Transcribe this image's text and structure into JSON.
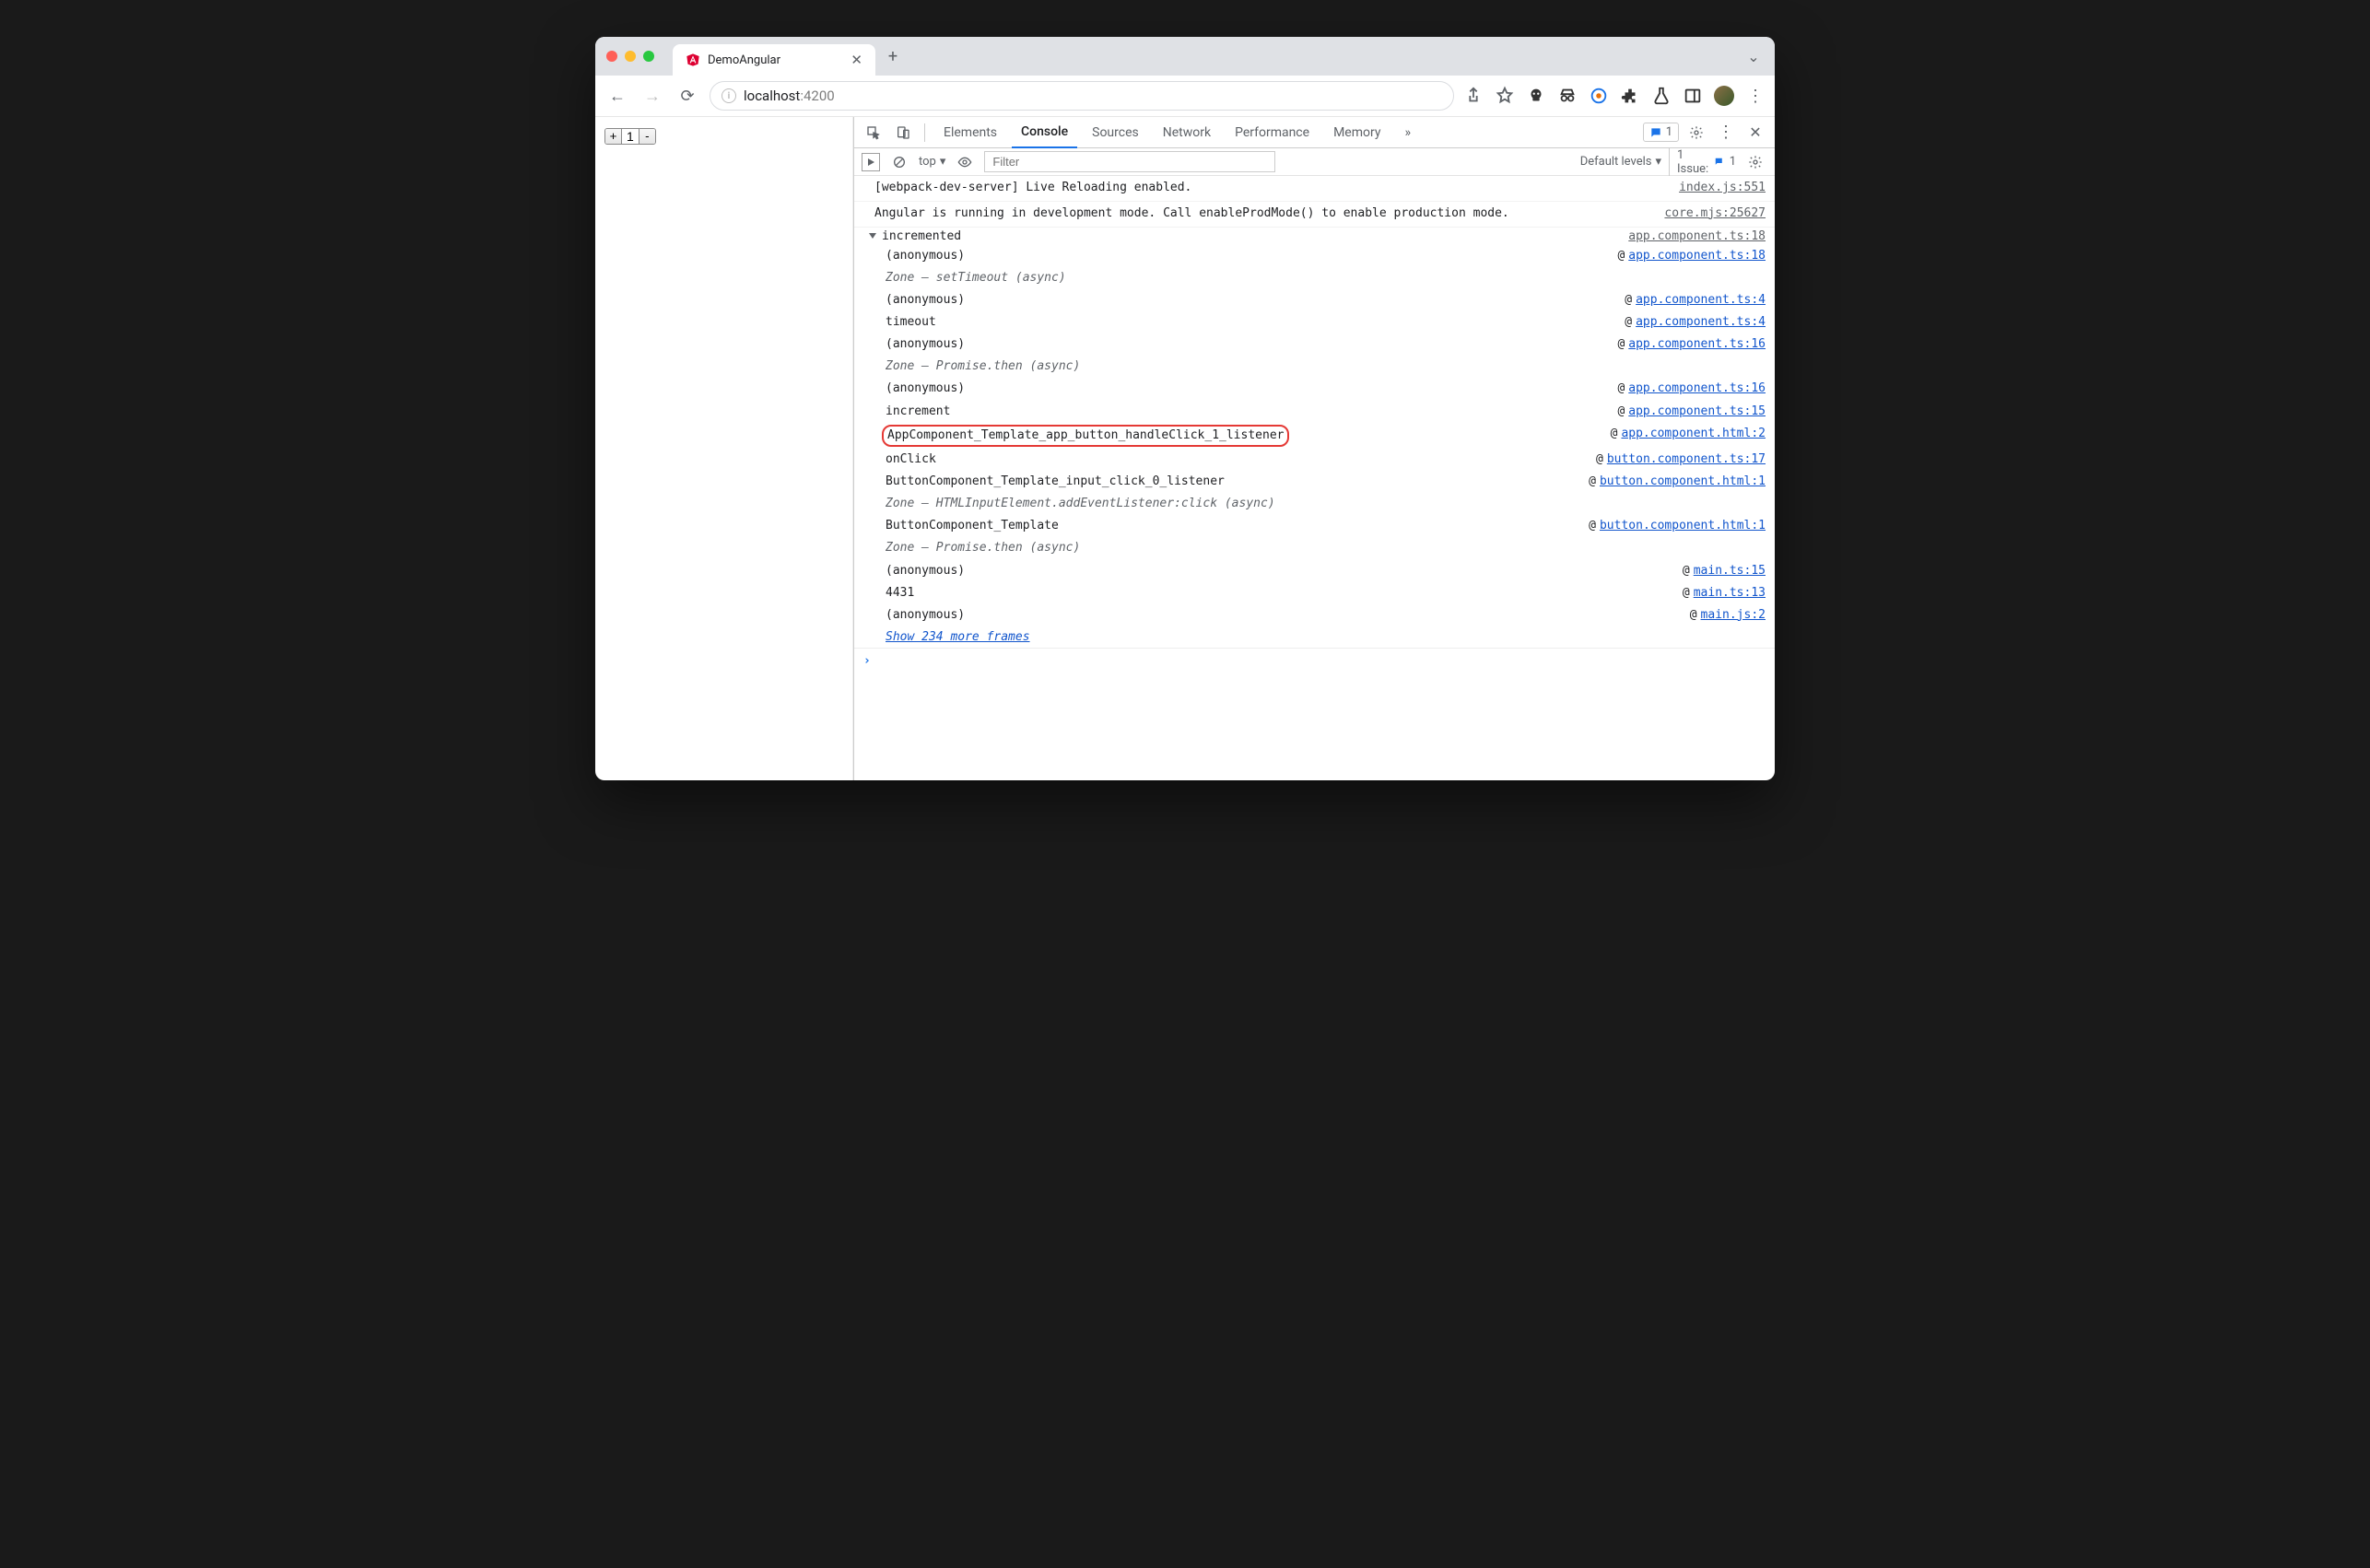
{
  "tab": {
    "title": "DemoAngular"
  },
  "omnibox": {
    "host": "localhost",
    "port": ":4200"
  },
  "page": {
    "plus": "+",
    "minus": "-",
    "value": "1"
  },
  "devtools": {
    "tabs": {
      "elements": "Elements",
      "console": "Console",
      "sources": "Sources",
      "network": "Network",
      "performance": "Performance",
      "memory": "Memory"
    },
    "overflow": "»",
    "activity_count": "1",
    "subbar": {
      "context": "top",
      "filter_placeholder": "Filter",
      "levels": "Default levels",
      "issues_label": "1 Issue:",
      "issues_count": "1"
    },
    "logs": [
      {
        "msg": "[webpack-dev-server] Live Reloading enabled.",
        "src": "index.js:551"
      },
      {
        "msg": "Angular is running in development mode. Call enableProdMode() to enable production mode.",
        "src": "core.mjs:25627"
      }
    ],
    "trace": {
      "head": "incremented",
      "head_src": "app.component.ts:18",
      "frames": [
        {
          "fn": "(anonymous)",
          "loc": "app.component.ts:18"
        },
        {
          "fn": "Zone — setTimeout (async)",
          "zone": true
        },
        {
          "fn": "(anonymous)",
          "loc": "app.component.ts:4"
        },
        {
          "fn": "timeout",
          "loc": "app.component.ts:4"
        },
        {
          "fn": "(anonymous)",
          "loc": "app.component.ts:16"
        },
        {
          "fn": "Zone — Promise.then (async)",
          "zone": true
        },
        {
          "fn": "(anonymous)",
          "loc": "app.component.ts:16"
        },
        {
          "fn": "increment",
          "loc": "app.component.ts:15"
        },
        {
          "fn": "AppComponent_Template_app_button_handleClick_1_listener",
          "loc": "app.component.html:2",
          "highlight": true
        },
        {
          "fn": "onClick",
          "loc": "button.component.ts:17"
        },
        {
          "fn": "ButtonComponent_Template_input_click_0_listener",
          "loc": "button.component.html:1"
        },
        {
          "fn": "Zone — HTMLInputElement.addEventListener:click (async)",
          "zone": true
        },
        {
          "fn": "ButtonComponent_Template",
          "loc": "button.component.html:1"
        },
        {
          "fn": "Zone — Promise.then (async)",
          "zone": true
        },
        {
          "fn": "(anonymous)",
          "loc": "main.ts:15"
        },
        {
          "fn": "4431",
          "loc": "main.ts:13"
        },
        {
          "fn": "(anonymous)",
          "loc": "main.js:2"
        }
      ],
      "show_more": "Show 234 more frames"
    },
    "prompt": "›"
  }
}
